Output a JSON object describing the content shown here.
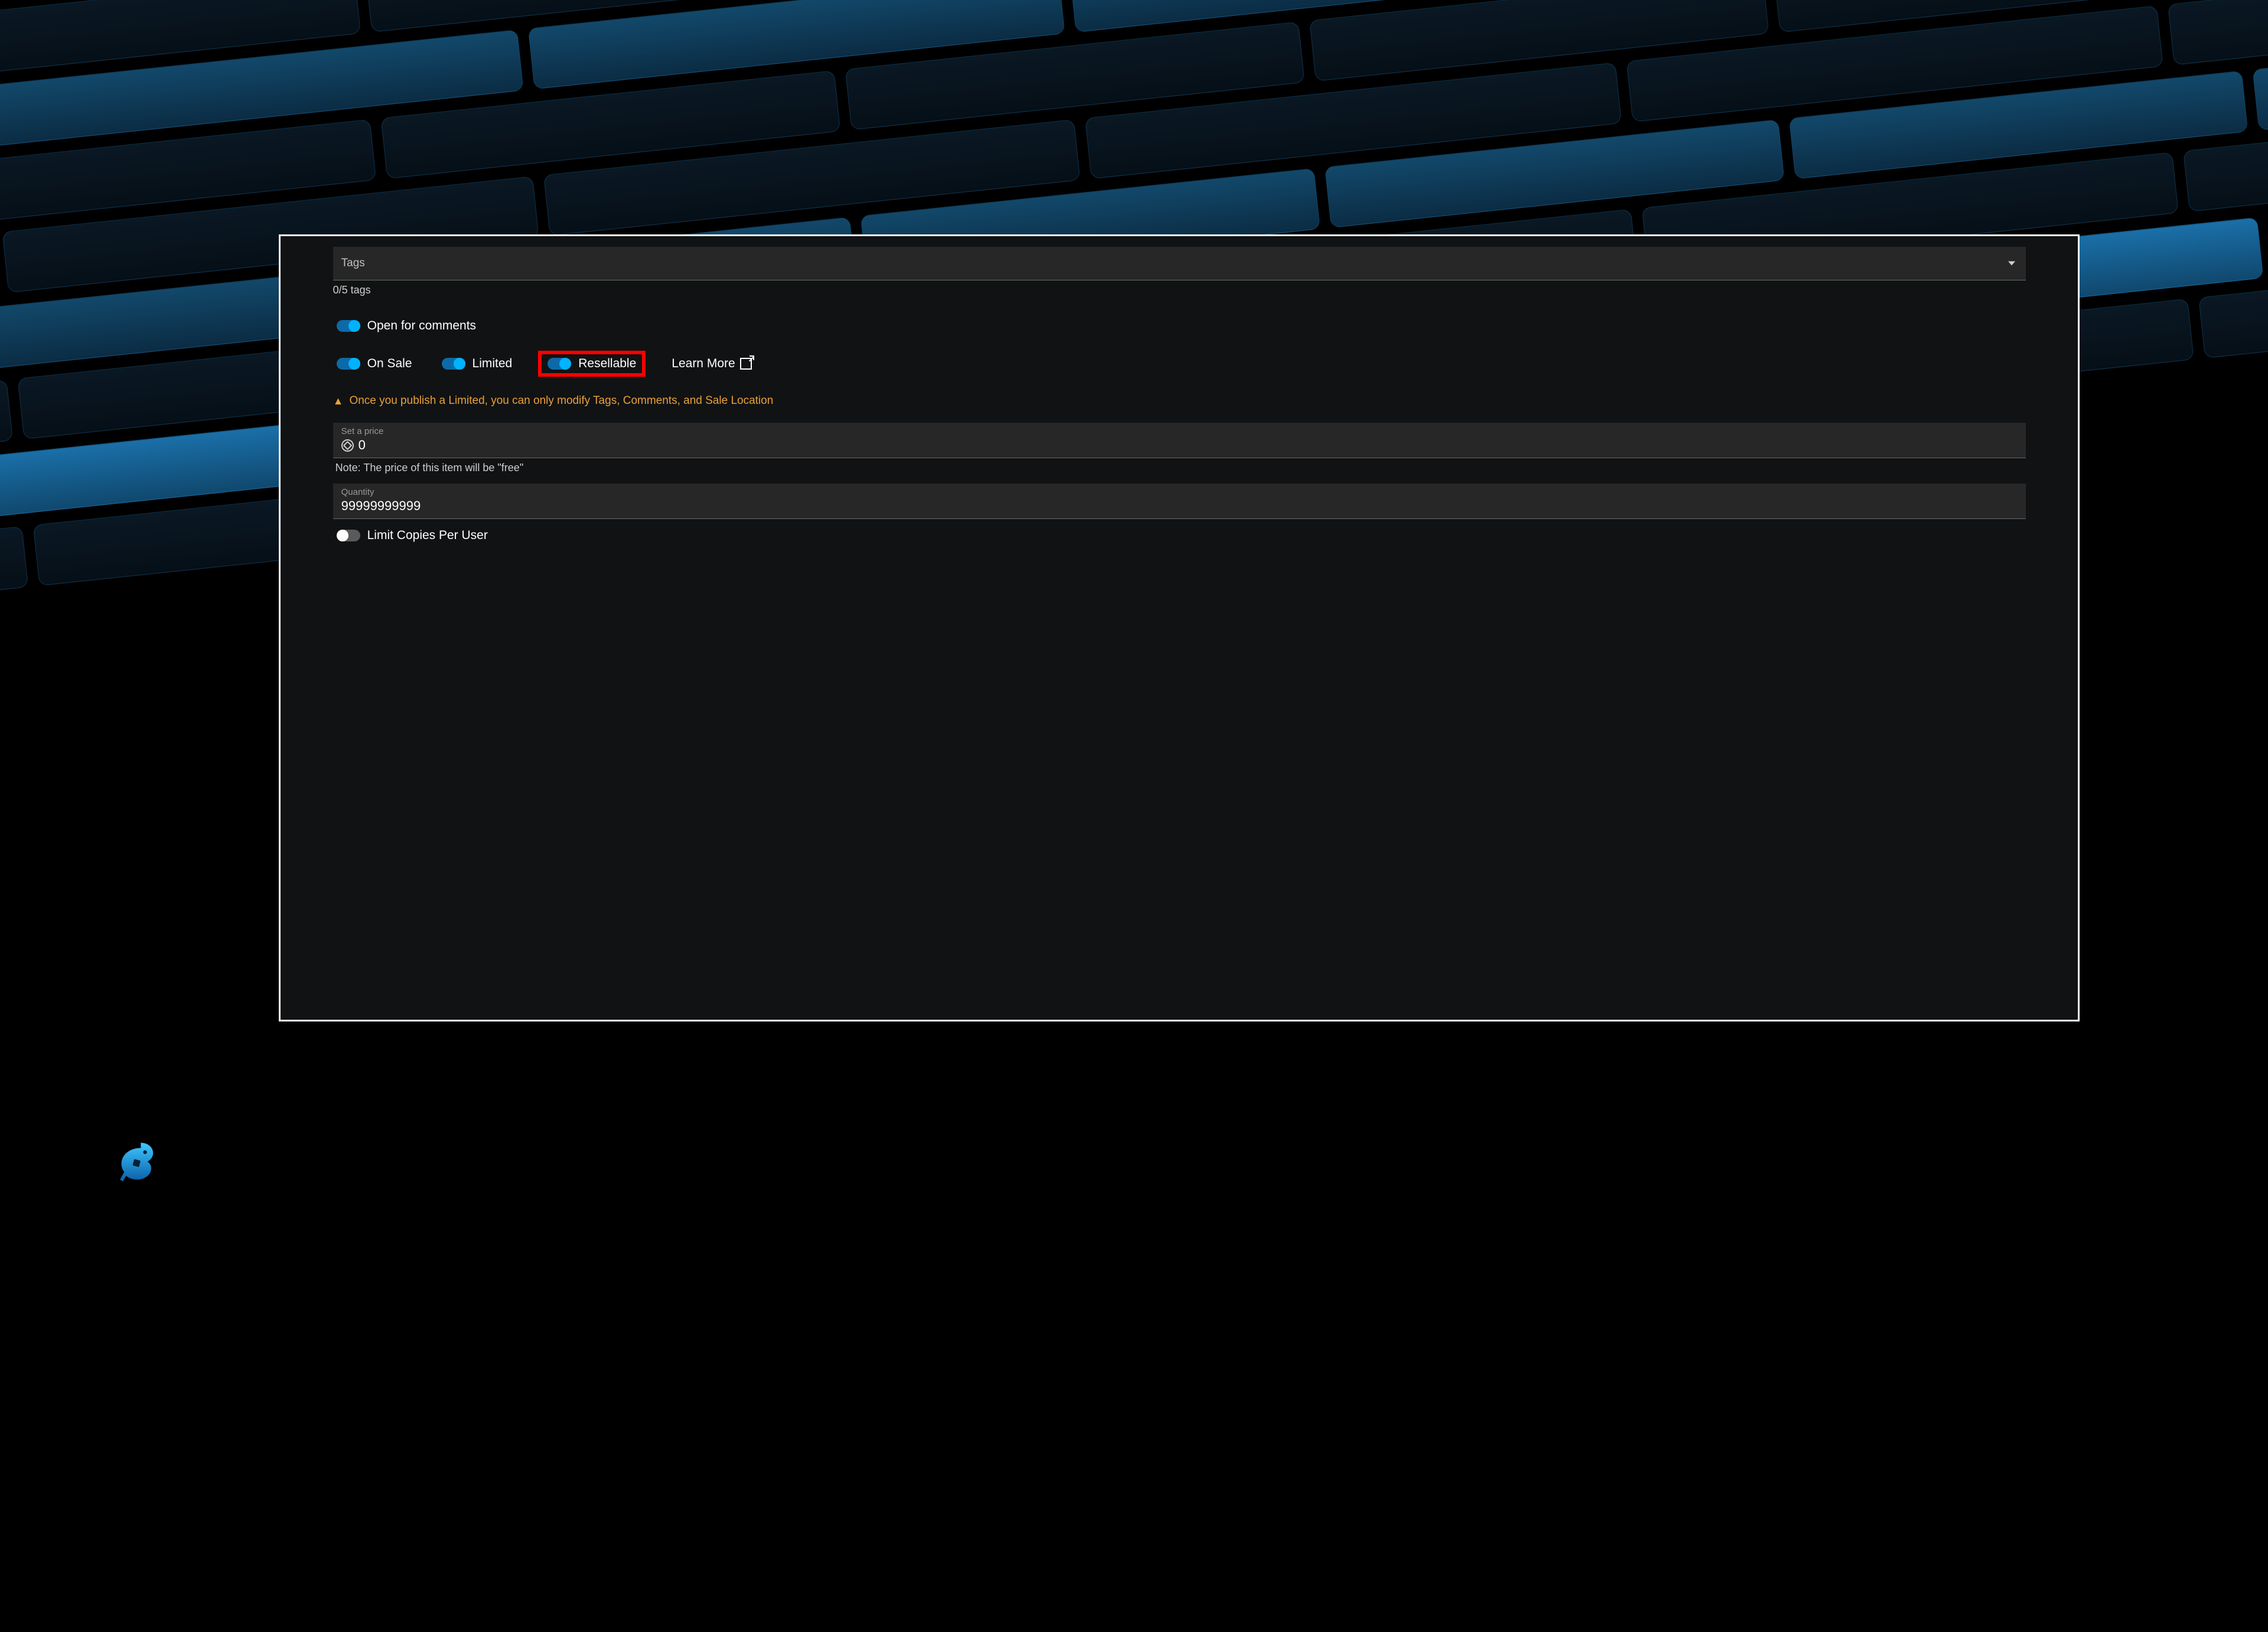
{
  "tags": {
    "placeholder": "Tags",
    "count_text": "0/5 tags"
  },
  "toggles": {
    "open_for_comments": {
      "label": "Open for comments",
      "on": true
    },
    "on_sale": {
      "label": "On Sale",
      "on": true
    },
    "limited": {
      "label": "Limited",
      "on": true
    },
    "resellable": {
      "label": "Resellable",
      "on": true
    },
    "limit_copies": {
      "label": "Limit Copies Per User",
      "on": false
    }
  },
  "learn_more": "Learn More",
  "warning_text": "Once you publish a Limited, you can only modify Tags, Comments, and Sale Location",
  "price": {
    "label": "Set a price",
    "value": "0",
    "note": "Note: The price of this item will be \"free\""
  },
  "quantity": {
    "label": "Quantity",
    "value": "99999999999"
  }
}
